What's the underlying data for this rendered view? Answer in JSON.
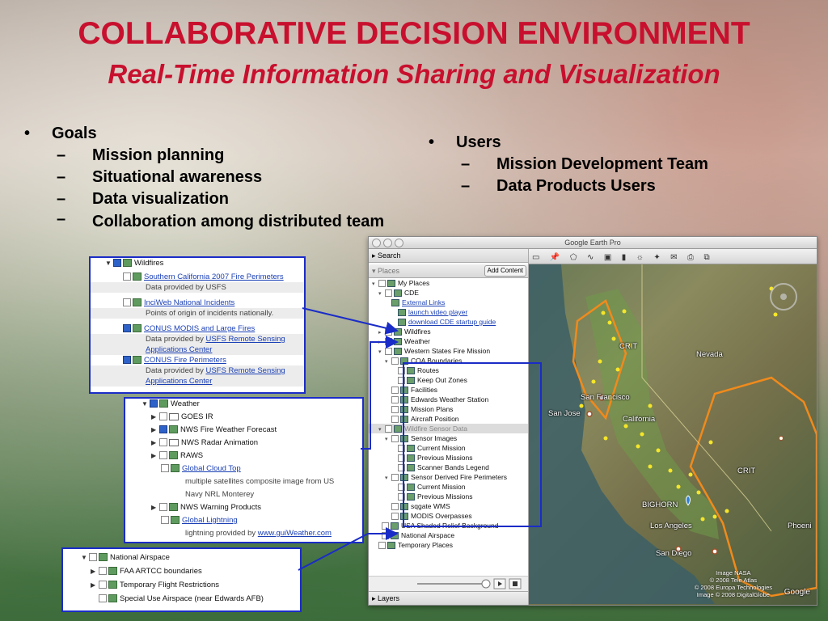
{
  "slide": {
    "title": "COLLABORATIVE DECISION ENVIRONMENT",
    "subtitle": "Real-Time Information Sharing and Visualization"
  },
  "goals": {
    "bullet": "•",
    "label": "Goals",
    "dash": "–",
    "items": [
      "Mission planning",
      "Situational awareness",
      "Data visualization",
      "Collaboration among distributed team"
    ]
  },
  "users": {
    "bullet": "•",
    "label": "Users",
    "dash": "–",
    "items": [
      "Mission Development Team",
      "Data Products Users"
    ]
  },
  "google_earth": {
    "window_title": "Google Earth Pro",
    "search_label": "▸ Search",
    "places_label": "▾ Places",
    "add_content_button": "Add Content",
    "layers_label": "▸ Layers",
    "tree": [
      "My Places",
      "CDE",
      "External Links",
      "launch video player",
      "download CDE startup guide",
      "Wildfires",
      "Weather",
      "Western States Fire Mission",
      "COA Boundaries",
      "Routes",
      "Keep Out Zones",
      "Facilities",
      "Edwards Weather Station",
      "Mission Plans",
      "Aircraft Position",
      "Wildfire Sensor Data",
      "Sensor Images",
      "Current Mission",
      "Previous Missions",
      "Scanner Bands Legend",
      "Sensor Derived Fire Perimeters",
      "Current Mission",
      "Previous Missions",
      "sqgate WMS",
      "MODIS Overpasses",
      "USA Shaded Relief Background",
      "National Airspace",
      "Temporary Places"
    ],
    "map_labels": [
      "CRIT",
      "Nevada",
      "San Francisco",
      "San Jose",
      "California",
      "CRIT",
      "BIGHORN",
      "Los Angeles",
      "San Diego",
      "Phoeni"
    ],
    "credits": [
      "Image NASA",
      "© 2008 Tele Atlas",
      "© 2008 Europa Technologies",
      "Image © 2008 DigitalGlobe"
    ],
    "map_brand": "Google"
  },
  "wildfires_box": {
    "folder": "Wildfires",
    "rows": [
      {
        "text": "Southern California 2007 Fire Perimeters",
        "type": "link"
      },
      {
        "text": "Data provided by USFS",
        "type": "note"
      },
      {
        "text": "InciWeb National Incidents",
        "type": "link"
      },
      {
        "text": "Points of origin of incidents nationally.",
        "type": "note"
      },
      {
        "text": "CONUS MODIS and Large Fires",
        "type": "link"
      },
      {
        "text": "Data provided by ",
        "type": "note",
        "link": "USFS Remote Sensing"
      },
      {
        "text": "Applications Center",
        "type": "link"
      },
      {
        "text": "CONUS Fire Perimeters",
        "type": "link"
      },
      {
        "text": "Data provided by ",
        "type": "note",
        "link": "USFS Remote Sensing"
      },
      {
        "text": "Applications Center",
        "type": "link"
      }
    ]
  },
  "weather_box": {
    "folder": "Weather",
    "rows": [
      "GOES IR",
      "NWS Fire Weather Forecast",
      "NWS Radar Animation",
      "RAWS",
      "Global Cloud Top",
      "multiple satellites composite image from US",
      "Navy NRL Monterey",
      "NWS Warning Products",
      "Global Lightning",
      "lightning provided by ",
      "www.guiWeather.com"
    ]
  },
  "airspace_box": {
    "folder": "National Airspace",
    "rows": [
      "FAA ARTCC boundaries",
      "Temporary Flight Restrictions",
      "Special Use Airspace (near Edwards AFB)"
    ]
  },
  "colors": {
    "title": "#c8102e",
    "callout_border": "#1a2cc7",
    "link": "#1a3fb5",
    "boundary_orange": "#f08a1c",
    "fire_dot": "#f5e62a"
  }
}
